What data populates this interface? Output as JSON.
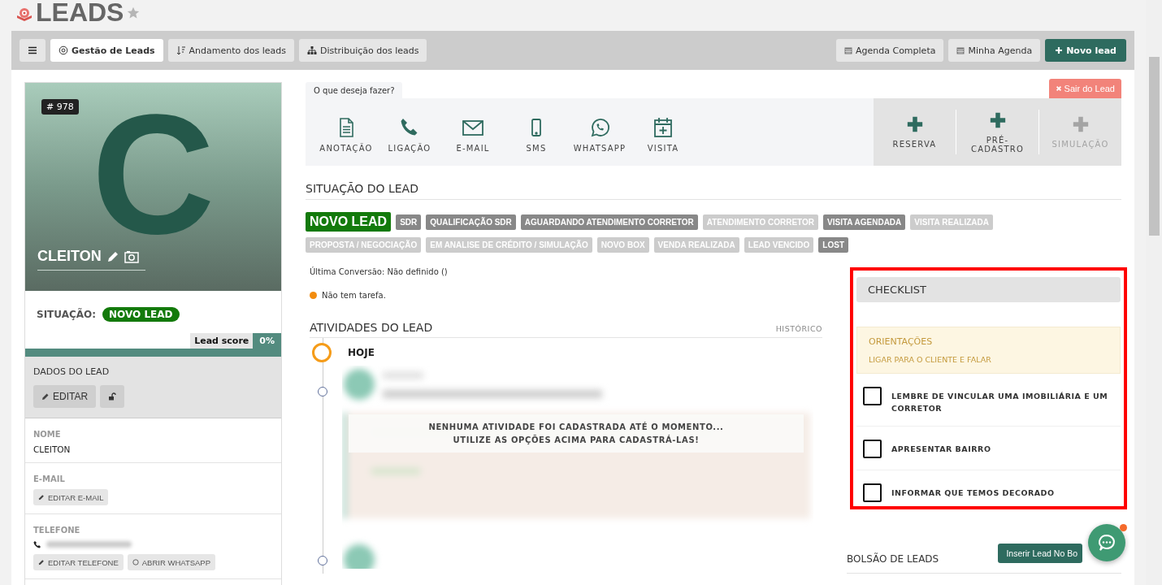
{
  "page_title": "LEADS",
  "toolbar": {
    "tabs": [
      {
        "label": "Gestão de Leads",
        "selected": true
      },
      {
        "label": "Andamento dos leads",
        "selected": false
      },
      {
        "label": "Distribuição dos leads",
        "selected": false
      }
    ],
    "buttons": [
      {
        "label": "Agenda Completa",
        "kind": "calendar"
      },
      {
        "label": "Minha Agenda",
        "kind": "calendar"
      },
      {
        "label": "Novo lead",
        "kind": "primary"
      }
    ]
  },
  "lead": {
    "number": "# 978",
    "initial": "C",
    "name": "CLEITON",
    "situation_label": "SITUAÇÃO:",
    "situation": "NOVO LEAD",
    "score_label": "Lead score",
    "score": "0%"
  },
  "data_section": {
    "title": "DADOS DO LEAD",
    "edit": "EDITAR",
    "fields": [
      {
        "label": "NOME",
        "kind": "text",
        "value": "CLEITON"
      },
      {
        "label": "E-MAIL",
        "kind": "email",
        "buttons": [
          "EDITAR E-MAIL"
        ]
      },
      {
        "label": "TELEFONE",
        "kind": "phone",
        "buttons": [
          "EDITAR TELEFONE",
          "ABRIR WHATSAPP"
        ]
      }
    ]
  },
  "actions": {
    "tab": "O que deseja fazer?",
    "sair": "Sair do Lead",
    "items": [
      {
        "label": "ANOTAÇÃO"
      },
      {
        "label": "LIGAÇÃO"
      },
      {
        "label": "E-MAIL"
      },
      {
        "label": "SMS"
      },
      {
        "label": "WHATSAPP"
      },
      {
        "label": "VISITA"
      }
    ],
    "extra": [
      {
        "label": "RESERVA",
        "disabled": false
      },
      {
        "label": "PRÉ-CADASTRO",
        "disabled": false
      },
      {
        "label": "SIMULAÇÃO",
        "disabled": true
      }
    ]
  },
  "situation": {
    "title": "SITUAÇÃO DO LEAD",
    "stages": [
      {
        "label": "NOVO LEAD",
        "kind": "current"
      },
      {
        "label": "SDR",
        "kind": "dark"
      },
      {
        "label": "QUALIFICAÇÃO SDR",
        "kind": "dark"
      },
      {
        "label": "AGUARDANDO ATENDIMENTO CORRETOR",
        "kind": "dark"
      },
      {
        "label": "ATENDIMENTO CORRETOR",
        "kind": "light"
      },
      {
        "label": "VISITA AGENDADA",
        "kind": "dark"
      },
      {
        "label": "VISITA REALIZADA",
        "kind": "light"
      },
      {
        "label": "PROPOSTA / NEGOCIAÇÃO",
        "kind": "light"
      },
      {
        "label": "EM ANALISE DE CRÉDITO / SIMULAÇÃO",
        "kind": "light"
      },
      {
        "label": "NOVO BOX",
        "kind": "light"
      },
      {
        "label": "VENDA REALIZADA",
        "kind": "light"
      },
      {
        "label": "LEAD VENCIDO",
        "kind": "light"
      },
      {
        "label": "LOST",
        "kind": "dark"
      }
    ]
  },
  "conversion": "Última Conversão: Não definido ()",
  "task": {
    "text": "Não tem tarefa.",
    "color": "#f28c0f"
  },
  "activities": {
    "title": "ATIVIDADES DO LEAD",
    "history": "HISTÓRICO",
    "today": "HOJE",
    "empty": [
      "NENHUMA ATIVIDADE FOI CADASTRADA ATÉ O MOMENTO...",
      "UTILIZE AS OPÇÕES ACIMA PARA CADASTRÁ-LAS!"
    ]
  },
  "checklist": {
    "title": "CHECKLIST",
    "guide_title": "ORIENTAÇÕES",
    "guide_text": "LIGAR PARA O CLIENTE E FALAR",
    "items": [
      {
        "label": "LEMBRE DE VINCULAR UMA IMOBILIÁRIA E UM CORRETOR",
        "checked": false
      },
      {
        "label": "APRESENTAR BAIRRO",
        "checked": false
      },
      {
        "label": "INFORMAR QUE TEMOS DECORADO",
        "checked": false
      }
    ]
  },
  "pocket": {
    "title": "BOLSÃO DE LEADS",
    "button": "Inserir Lead No Bo"
  },
  "chat": {
    "unread": true
  }
}
